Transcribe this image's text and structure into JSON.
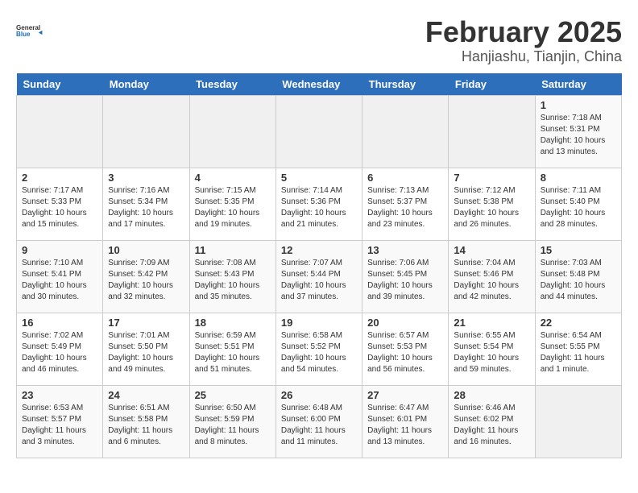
{
  "header": {
    "logo_line1": "General",
    "logo_line2": "Blue",
    "title": "February 2025",
    "subtitle": "Hanjiashu, Tianjin, China"
  },
  "weekdays": [
    "Sunday",
    "Monday",
    "Tuesday",
    "Wednesday",
    "Thursday",
    "Friday",
    "Saturday"
  ],
  "weeks": [
    [
      {
        "day": "",
        "info": ""
      },
      {
        "day": "",
        "info": ""
      },
      {
        "day": "",
        "info": ""
      },
      {
        "day": "",
        "info": ""
      },
      {
        "day": "",
        "info": ""
      },
      {
        "day": "",
        "info": ""
      },
      {
        "day": "1",
        "info": "Sunrise: 7:18 AM\nSunset: 5:31 PM\nDaylight: 10 hours\nand 13 minutes."
      }
    ],
    [
      {
        "day": "2",
        "info": "Sunrise: 7:17 AM\nSunset: 5:33 PM\nDaylight: 10 hours\nand 15 minutes."
      },
      {
        "day": "3",
        "info": "Sunrise: 7:16 AM\nSunset: 5:34 PM\nDaylight: 10 hours\nand 17 minutes."
      },
      {
        "day": "4",
        "info": "Sunrise: 7:15 AM\nSunset: 5:35 PM\nDaylight: 10 hours\nand 19 minutes."
      },
      {
        "day": "5",
        "info": "Sunrise: 7:14 AM\nSunset: 5:36 PM\nDaylight: 10 hours\nand 21 minutes."
      },
      {
        "day": "6",
        "info": "Sunrise: 7:13 AM\nSunset: 5:37 PM\nDaylight: 10 hours\nand 23 minutes."
      },
      {
        "day": "7",
        "info": "Sunrise: 7:12 AM\nSunset: 5:38 PM\nDaylight: 10 hours\nand 26 minutes."
      },
      {
        "day": "8",
        "info": "Sunrise: 7:11 AM\nSunset: 5:40 PM\nDaylight: 10 hours\nand 28 minutes."
      }
    ],
    [
      {
        "day": "9",
        "info": "Sunrise: 7:10 AM\nSunset: 5:41 PM\nDaylight: 10 hours\nand 30 minutes."
      },
      {
        "day": "10",
        "info": "Sunrise: 7:09 AM\nSunset: 5:42 PM\nDaylight: 10 hours\nand 32 minutes."
      },
      {
        "day": "11",
        "info": "Sunrise: 7:08 AM\nSunset: 5:43 PM\nDaylight: 10 hours\nand 35 minutes."
      },
      {
        "day": "12",
        "info": "Sunrise: 7:07 AM\nSunset: 5:44 PM\nDaylight: 10 hours\nand 37 minutes."
      },
      {
        "day": "13",
        "info": "Sunrise: 7:06 AM\nSunset: 5:45 PM\nDaylight: 10 hours\nand 39 minutes."
      },
      {
        "day": "14",
        "info": "Sunrise: 7:04 AM\nSunset: 5:46 PM\nDaylight: 10 hours\nand 42 minutes."
      },
      {
        "day": "15",
        "info": "Sunrise: 7:03 AM\nSunset: 5:48 PM\nDaylight: 10 hours\nand 44 minutes."
      }
    ],
    [
      {
        "day": "16",
        "info": "Sunrise: 7:02 AM\nSunset: 5:49 PM\nDaylight: 10 hours\nand 46 minutes."
      },
      {
        "day": "17",
        "info": "Sunrise: 7:01 AM\nSunset: 5:50 PM\nDaylight: 10 hours\nand 49 minutes."
      },
      {
        "day": "18",
        "info": "Sunrise: 6:59 AM\nSunset: 5:51 PM\nDaylight: 10 hours\nand 51 minutes."
      },
      {
        "day": "19",
        "info": "Sunrise: 6:58 AM\nSunset: 5:52 PM\nDaylight: 10 hours\nand 54 minutes."
      },
      {
        "day": "20",
        "info": "Sunrise: 6:57 AM\nSunset: 5:53 PM\nDaylight: 10 hours\nand 56 minutes."
      },
      {
        "day": "21",
        "info": "Sunrise: 6:55 AM\nSunset: 5:54 PM\nDaylight: 10 hours\nand 59 minutes."
      },
      {
        "day": "22",
        "info": "Sunrise: 6:54 AM\nSunset: 5:55 PM\nDaylight: 11 hours\nand 1 minute."
      }
    ],
    [
      {
        "day": "23",
        "info": "Sunrise: 6:53 AM\nSunset: 5:57 PM\nDaylight: 11 hours\nand 3 minutes."
      },
      {
        "day": "24",
        "info": "Sunrise: 6:51 AM\nSunset: 5:58 PM\nDaylight: 11 hours\nand 6 minutes."
      },
      {
        "day": "25",
        "info": "Sunrise: 6:50 AM\nSunset: 5:59 PM\nDaylight: 11 hours\nand 8 minutes."
      },
      {
        "day": "26",
        "info": "Sunrise: 6:48 AM\nSunset: 6:00 PM\nDaylight: 11 hours\nand 11 minutes."
      },
      {
        "day": "27",
        "info": "Sunrise: 6:47 AM\nSunset: 6:01 PM\nDaylight: 11 hours\nand 13 minutes."
      },
      {
        "day": "28",
        "info": "Sunrise: 6:46 AM\nSunset: 6:02 PM\nDaylight: 11 hours\nand 16 minutes."
      },
      {
        "day": "",
        "info": ""
      }
    ]
  ]
}
